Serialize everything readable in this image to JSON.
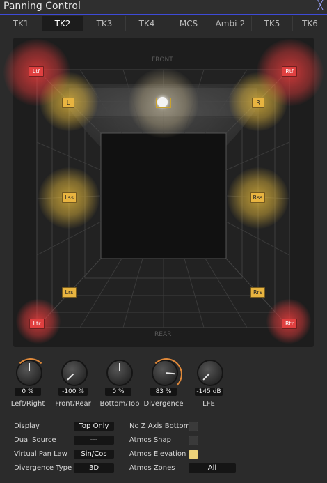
{
  "window": {
    "title": "Panning Control",
    "close_glyph": "╳"
  },
  "tabs": [
    {
      "label": "TK1"
    },
    {
      "label": "TK2"
    },
    {
      "label": "TK3"
    },
    {
      "label": "TK4"
    },
    {
      "label": "MCS"
    },
    {
      "label": "Ambi-2"
    },
    {
      "label": "TK5"
    },
    {
      "label": "TK6"
    }
  ],
  "active_tab": "TK2",
  "panner": {
    "front_label": "FRONT",
    "rear_label": "REAR",
    "speakers": {
      "ltf": "Ltf",
      "rtf": "Rtf",
      "l": "L",
      "r": "R",
      "lss": "Lss",
      "rss": "Rss",
      "lrs": "Lrs",
      "rrs": "Rrs",
      "ltr": "Ltr",
      "rtr": "Rtr"
    }
  },
  "knobs": {
    "left_right": {
      "value": "0 %",
      "label": "Left/Right"
    },
    "front_rear": {
      "value": "-100 %",
      "label": "Front/Rear"
    },
    "bottom_top": {
      "value": "0 %",
      "label": "Bottom/Top"
    },
    "divergence": {
      "value": "83 %",
      "label": "Divergence"
    },
    "lfe": {
      "value": "-145 dB",
      "label": "LFE"
    }
  },
  "options": {
    "display": {
      "label": "Display",
      "value": "Top Only"
    },
    "dual_source": {
      "label": "Dual Source",
      "value": "---"
    },
    "virtual_pan_law": {
      "label": "Virtual Pan Law",
      "value": "Sin/Cos"
    },
    "divergence_type": {
      "label": "Divergence Type",
      "value": "3D"
    },
    "no_z_axis_bottom": {
      "label": "No Z Axis Bottom",
      "checked": false
    },
    "atmos_snap": {
      "label": "Atmos Snap",
      "checked": false
    },
    "atmos_elevation": {
      "label": "Atmos Elevation",
      "checked": true
    },
    "atmos_zones": {
      "label": "Atmos Zones",
      "value": "All"
    }
  },
  "colors": {
    "accent": "#3e4bd8",
    "speaker_yellow": "#e8b440",
    "speaker_red": "#e04040",
    "knob_accent": "#e0893a"
  }
}
